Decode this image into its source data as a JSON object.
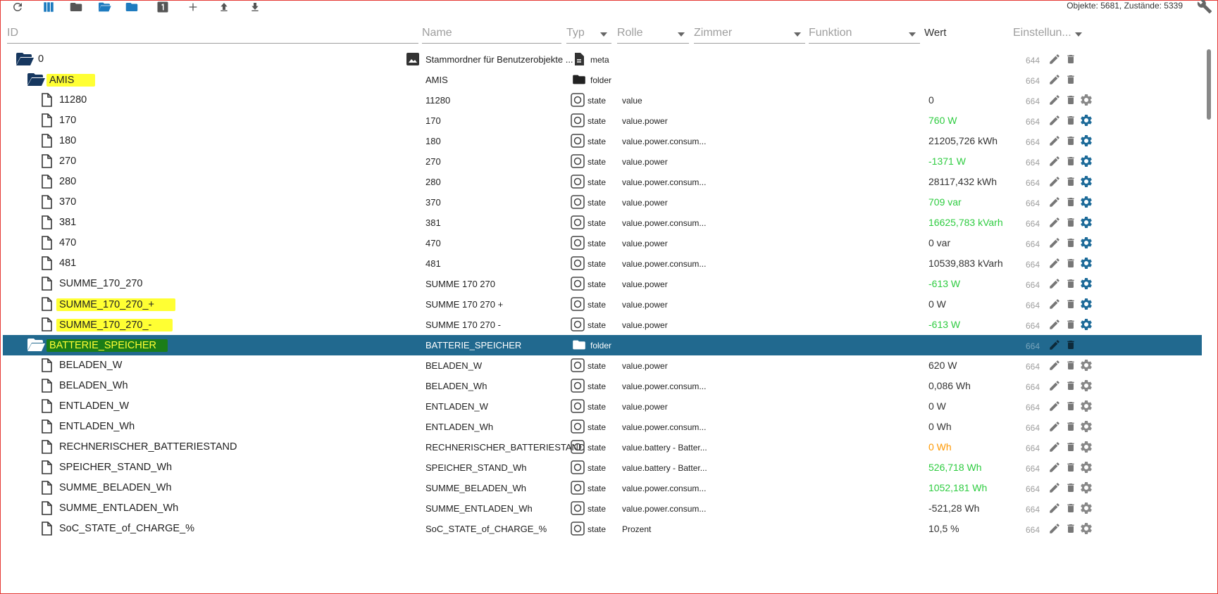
{
  "toolbar": {
    "counts": "Objekte: 5681, Zustände: 5339",
    "icons": [
      "refresh-icon",
      "columns-icon",
      "folder-icon",
      "folder-open-icon",
      "folder-blue-icon",
      "number-one-icon",
      "add-icon",
      "upload-icon",
      "download-icon"
    ]
  },
  "header": {
    "id": "ID",
    "name": "Name",
    "typ": "Typ",
    "rolle": "Rolle",
    "zimmer": "Zimmer",
    "funktion": "Funktion",
    "wert": "Wert",
    "einstellungen": "Einstellun..."
  },
  "colors": {
    "selected_bg": "#21698f",
    "highlight_yellow": "#ffff33",
    "highlight_green": "#1b7d17",
    "value_green": "#2ecc40",
    "value_orange": "#ff9800",
    "gear_blue": "#1e6b99",
    "folder_dark": "#16375f"
  },
  "rows": [
    {
      "id": "0",
      "indent": 0,
      "kind": "folder-open",
      "name": "Stammordner für Benutzerobjekte ...",
      "nameIcon": "image",
      "type": "meta",
      "typeIcon": "meta",
      "role": "",
      "value": "",
      "valueColor": "",
      "rights": "644",
      "gear": "none"
    },
    {
      "id": "AMIS",
      "indent": 1,
      "kind": "folder-open",
      "highlight": "yellow",
      "name": "AMIS",
      "type": "folder",
      "typeIcon": "folder",
      "role": "",
      "value": "",
      "valueColor": "",
      "rights": "664",
      "gear": "none"
    },
    {
      "id": "11280",
      "indent": 2,
      "kind": "file",
      "name": "11280",
      "type": "state",
      "typeIcon": "state",
      "role": "value",
      "value": "0",
      "valueColor": "normal",
      "rights": "664",
      "gear": "gray"
    },
    {
      "id": "170",
      "indent": 2,
      "kind": "file",
      "name": "170",
      "type": "state",
      "typeIcon": "state",
      "role": "value.power",
      "value": "760 W",
      "valueColor": "green",
      "rights": "664",
      "gear": "blue"
    },
    {
      "id": "180",
      "indent": 2,
      "kind": "file",
      "name": "180",
      "type": "state",
      "typeIcon": "state",
      "role": "value.power.consum...",
      "value": "21205,726 kWh",
      "valueColor": "normal",
      "rights": "664",
      "gear": "blue"
    },
    {
      "id": "270",
      "indent": 2,
      "kind": "file",
      "name": "270",
      "type": "state",
      "typeIcon": "state",
      "role": "value.power",
      "value": "-1371 W",
      "valueColor": "green",
      "rights": "664",
      "gear": "blue"
    },
    {
      "id": "280",
      "indent": 2,
      "kind": "file",
      "name": "280",
      "type": "state",
      "typeIcon": "state",
      "role": "value.power.consum...",
      "value": "28117,432 kWh",
      "valueColor": "normal",
      "rights": "664",
      "gear": "blue"
    },
    {
      "id": "370",
      "indent": 2,
      "kind": "file",
      "name": "370",
      "type": "state",
      "typeIcon": "state",
      "role": "value.power",
      "value": "709 var",
      "valueColor": "green",
      "rights": "664",
      "gear": "blue"
    },
    {
      "id": "381",
      "indent": 2,
      "kind": "file",
      "name": "381",
      "type": "state",
      "typeIcon": "state",
      "role": "value.power.consum...",
      "value": "16625,783 kVarh",
      "valueColor": "green",
      "rights": "664",
      "gear": "blue"
    },
    {
      "id": "470",
      "indent": 2,
      "kind": "file",
      "name": "470",
      "type": "state",
      "typeIcon": "state",
      "role": "value.power",
      "value": "0 var",
      "valueColor": "normal",
      "rights": "664",
      "gear": "blue"
    },
    {
      "id": "481",
      "indent": 2,
      "kind": "file",
      "name": "481",
      "type": "state",
      "typeIcon": "state",
      "role": "value.power.consum...",
      "value": "10539,883 kVarh",
      "valueColor": "normal",
      "rights": "664",
      "gear": "blue"
    },
    {
      "id": "SUMME_170_270",
      "indent": 2,
      "kind": "file",
      "name": "SUMME 170 270",
      "type": "state",
      "typeIcon": "state",
      "role": "value.power",
      "value": "-613 W",
      "valueColor": "green",
      "rights": "664",
      "gear": "blue"
    },
    {
      "id": "SUMME_170_270_+",
      "indent": 2,
      "kind": "file",
      "highlight": "yellow",
      "name": "SUMME 170 270 +",
      "type": "state",
      "typeIcon": "state",
      "role": "value.power",
      "value": "0 W",
      "valueColor": "normal",
      "rights": "664",
      "gear": "blue"
    },
    {
      "id": "SUMME_170_270_-",
      "indent": 2,
      "kind": "file",
      "highlight": "yellow",
      "name": "SUMME 170 270 -",
      "type": "state",
      "typeIcon": "state",
      "role": "value.power",
      "value": "-613 W",
      "valueColor": "green",
      "rights": "664",
      "gear": "blue"
    },
    {
      "id": "BATTERIE_SPEICHER",
      "indent": 1,
      "kind": "folder-open",
      "highlight": "green",
      "selected": true,
      "name": "BATTERIE_SPEICHER",
      "type": "folder",
      "typeIcon": "folder",
      "role": "",
      "value": "",
      "valueColor": "",
      "rights": "664",
      "gear": "none"
    },
    {
      "id": "BELADEN_W",
      "indent": 2,
      "kind": "file",
      "name": "BELADEN_W",
      "type": "state",
      "typeIcon": "state",
      "role": "value.power",
      "value": "620 W",
      "valueColor": "normal",
      "rights": "664",
      "gear": "gray"
    },
    {
      "id": "BELADEN_Wh",
      "indent": 2,
      "kind": "file",
      "name": "BELADEN_Wh",
      "type": "state",
      "typeIcon": "state",
      "role": "value.power.consum...",
      "value": "0,086 Wh",
      "valueColor": "normal",
      "rights": "664",
      "gear": "gray"
    },
    {
      "id": "ENTLADEN_W",
      "indent": 2,
      "kind": "file",
      "name": "ENTLADEN_W",
      "type": "state",
      "typeIcon": "state",
      "role": "value.power",
      "value": "0 W",
      "valueColor": "normal",
      "rights": "664",
      "gear": "gray"
    },
    {
      "id": "ENTLADEN_Wh",
      "indent": 2,
      "kind": "file",
      "name": "ENTLADEN_Wh",
      "type": "state",
      "typeIcon": "state",
      "role": "value.power.consum...",
      "value": "0 Wh",
      "valueColor": "normal",
      "rights": "664",
      "gear": "gray"
    },
    {
      "id": "RECHNERISCHER_BATTERIESTAND",
      "indent": 2,
      "kind": "file",
      "name": "RECHNERISCHER_BATTERIESTAND",
      "type": "state",
      "typeIcon": "state",
      "role": "value.battery - Batter...",
      "value": "0 Wh",
      "valueColor": "orange",
      "rights": "664",
      "gear": "gray"
    },
    {
      "id": "SPEICHER_STAND_Wh",
      "indent": 2,
      "kind": "file",
      "name": "SPEICHER_STAND_Wh",
      "type": "state",
      "typeIcon": "state",
      "role": "value.battery - Batter...",
      "value": "526,718 Wh",
      "valueColor": "green",
      "rights": "664",
      "gear": "gray"
    },
    {
      "id": "SUMME_BELADEN_Wh",
      "indent": 2,
      "kind": "file",
      "name": "SUMME_BELADEN_Wh",
      "type": "state",
      "typeIcon": "state",
      "role": "value.power.consum...",
      "value": "1052,181 Wh",
      "valueColor": "green",
      "rights": "664",
      "gear": "gray"
    },
    {
      "id": "SUMME_ENTLADEN_Wh",
      "indent": 2,
      "kind": "file",
      "name": "SUMME_ENTLADEN_Wh",
      "type": "state",
      "typeIcon": "state",
      "role": "value.power.consum...",
      "value": "-521,28 Wh",
      "valueColor": "normal",
      "rights": "664",
      "gear": "gray"
    },
    {
      "id": "SoC_STATE_of_CHARGE_%",
      "indent": 2,
      "kind": "file",
      "name": "SoC_STATE_of_CHARGE_%",
      "type": "state",
      "typeIcon": "state",
      "role": "Prozent",
      "value": "10,5 %",
      "valueColor": "normal",
      "rights": "664",
      "gear": "gray"
    }
  ]
}
